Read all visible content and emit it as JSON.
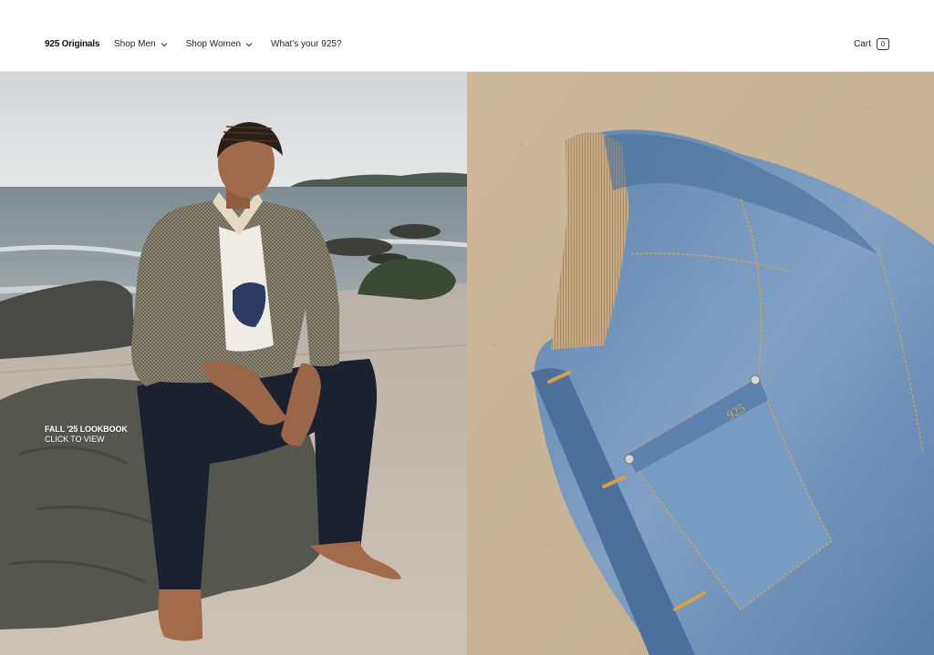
{
  "header": {
    "brand": "925 Originals",
    "nav": [
      {
        "label": "Shop Men",
        "has_dropdown": true,
        "icon": "chevron-down-icon"
      },
      {
        "label": "Shop Women",
        "has_dropdown": true,
        "icon": "chevron-down-icon"
      },
      {
        "label": "What's your 925?",
        "has_dropdown": false
      }
    ],
    "cart": {
      "label": "Cart",
      "count": "0"
    }
  },
  "hero": {
    "left": {
      "image": "model-on-beach-rock-photo",
      "caption_title": "FALL '25 LOOKBOOK",
      "caption_cta": "CLICK TO VIEW"
    },
    "right": {
      "image": "denim-jacket-on-sand-photo",
      "pocket_mark": "925"
    }
  },
  "colors": {
    "sky": "#d9dbdc",
    "sea": "#8e9aa0",
    "sand": "#c9b59a",
    "denim": "#6f8fb6",
    "text": "#111111"
  }
}
